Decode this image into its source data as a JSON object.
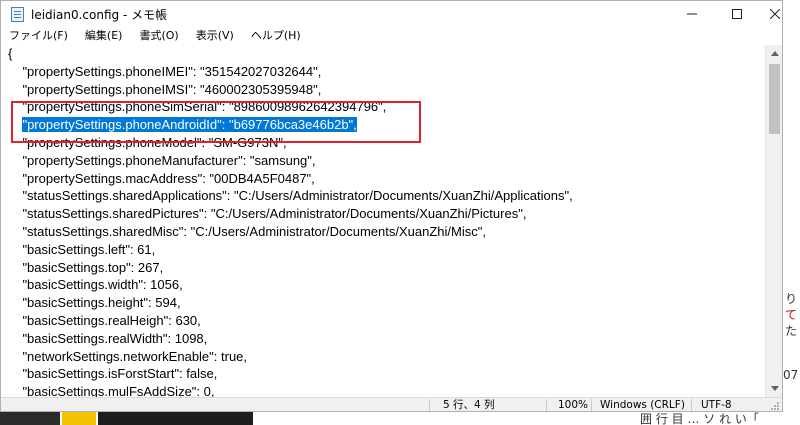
{
  "window": {
    "title": "leidian0.config - メモ帳",
    "controls": {
      "minimize": "─",
      "maximize": "☐",
      "close": "✕"
    }
  },
  "menu": {
    "items": [
      "ファイル(F)",
      "編集(E)",
      "書式(O)",
      "表示(V)",
      "ヘルプ(H)"
    ]
  },
  "editor": {
    "lines": [
      "{",
      "    \"propertySettings.phoneIMEI\": \"351542027032644\",",
      "    \"propertySettings.phoneIMSI\": \"460002305395948\",",
      "    \"propertySettings.phoneSimSerial\": \"89860098962642394796\",",
      "    \"propertySettings.phoneAndroidId\": \"b69776bca3e46b2b\",",
      "    \"propertySettings.phoneModel\": \"SM-G973N\",",
      "    \"propertySettings.phoneManufacturer\": \"samsung\",",
      "    \"propertySettings.macAddress\": \"00DB4A5F0487\",",
      "    \"statusSettings.sharedApplications\": \"C:/Users/Administrator/Documents/XuanZhi/Applications\",",
      "    \"statusSettings.sharedPictures\": \"C:/Users/Administrator/Documents/XuanZhi/Pictures\",",
      "    \"statusSettings.sharedMisc\": \"C:/Users/Administrator/Documents/XuanZhi/Misc\",",
      "    \"basicSettings.left\": 61,",
      "    \"basicSettings.top\": 267,",
      "    \"basicSettings.width\": 1056,",
      "    \"basicSettings.height\": 594,",
      "    \"basicSettings.realHeigh\": 630,",
      "    \"basicSettings.realWidth\": 1098,",
      "    \"networkSettings.networkEnable\": true,",
      "    \"basicSettings.isForstStart\": false,",
      "    \"basicSettings.mulFsAddSize\": 0,"
    ],
    "selected_line_index": 4,
    "selected_text": "\"propertySettings.phoneAndroidId\": \"b69776bca3e46b2b\","
  },
  "statusbar": {
    "position": "5 行、4 列",
    "zoom": "100%",
    "line_ending": "Windows (CRLF)",
    "encoding": "UTF-8"
  },
  "background": {
    "right_fragments": [
      "り",
      "て",
      "た"
    ],
    "bottom_fragment": "囲 行 目 … ソ れ い「",
    "right_fragment_2": "07"
  },
  "colors": {
    "selection": "#0078d7",
    "annotation_box": "#e0202a"
  }
}
